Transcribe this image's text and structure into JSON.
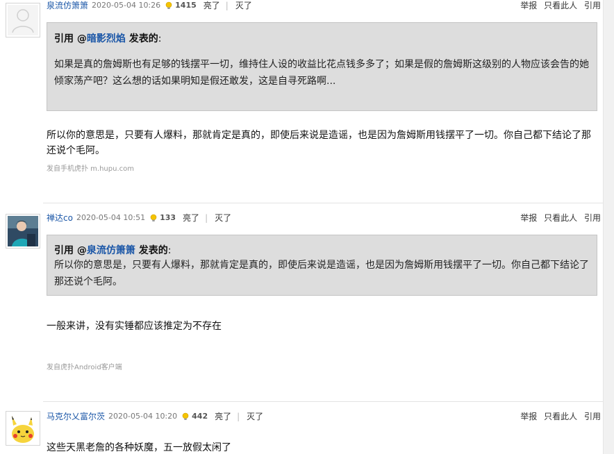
{
  "posts": [
    {
      "user": "泉流仿箫箫",
      "time": "2020-05-04 10:26",
      "light_count": "1415",
      "actions": {
        "light": "亮了",
        "separator": "|",
        "dim": "灭了"
      },
      "right_actions": [
        "举报",
        "只看此人",
        "引用"
      ],
      "avatar": "default-avatar-icon",
      "quote": {
        "prefix": "引用 @",
        "user": "暗影烈焰",
        "suffix": " 发表的",
        "colon": ":",
        "text": "如果是真的詹姆斯也有足够的钱摆平一切，维持住人设的收益比花点钱多多了；如果是假的詹姆斯这级别的人物应该会告的她倾家荡产吧？这么想的话如果明知是假还敢发，这是自寻死路啊..."
      },
      "body": "所以你的意思是，只要有人爆料，那就肯定是真的，即使后来说是造谣，也是因为詹姆斯用钱摆平了一切。你自己都下结论了那还说个毛阿。",
      "source": "发自手机虎扑 m.hupu.com"
    },
    {
      "user": "禅达co",
      "time": "2020-05-04 10:51",
      "light_count": "133",
      "actions": {
        "light": "亮了",
        "separator": "|",
        "dim": "灭了"
      },
      "right_actions": [
        "举报",
        "只看此人",
        "引用"
      ],
      "avatar": "user-photo-avatar",
      "quote": {
        "prefix": "引用 @",
        "user": "泉流仿箫箫",
        "suffix": " 发表的",
        "colon": ":",
        "text": "所以你的意思是，只要有人爆料，那就肯定是真的，即使后来说是造谣，也是因为詹姆斯用钱摆平了一切。你自己都下结论了那还说个毛阿。"
      },
      "body": "一般来讲，没有实锤都应该推定为不存在",
      "source": "发自虎扑Android客户端"
    },
    {
      "user": "马克尔乂富尔茨",
      "time": "2020-05-04 10:20",
      "light_count": "442",
      "actions": {
        "light": "亮了",
        "separator": "|",
        "dim": "灭了"
      },
      "right_actions": [
        "举报",
        "只看此人",
        "引用"
      ],
      "avatar": "pikachu-avatar",
      "body": "这些天黑老詹的各种妖魔，五一放假太闲了"
    }
  ],
  "colors": {
    "link": "#1a56a7",
    "quote_bg": "#dddddd",
    "quote_border": "#c4c4c4",
    "source": "#999999"
  }
}
